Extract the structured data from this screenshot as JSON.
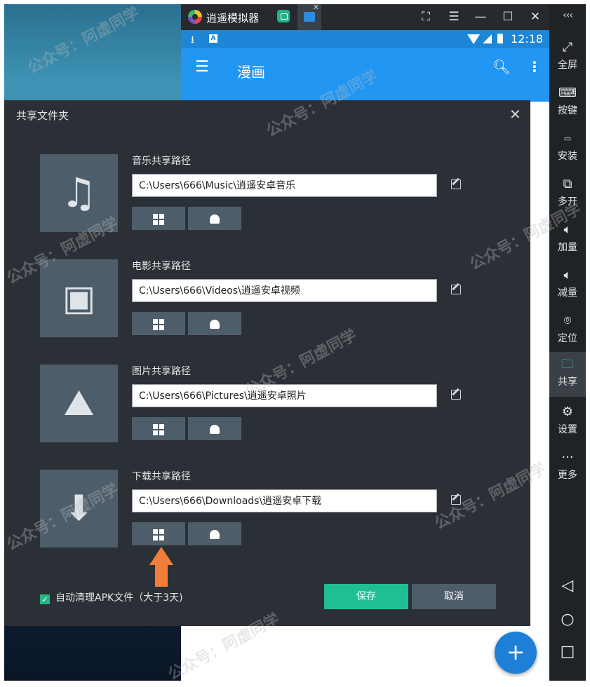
{
  "window": {
    "title": "逍遥模拟器",
    "status_time": "12:18",
    "app_title": "漫画"
  },
  "sidebar": {
    "items": [
      {
        "label": "全屏",
        "icon": "fullscreen-icon"
      },
      {
        "label": "按键",
        "icon": "keyboard-icon"
      },
      {
        "label": "安装",
        "icon": "apk-icon"
      },
      {
        "label": "多开",
        "icon": "multi-instance-icon"
      },
      {
        "label": "加量",
        "icon": "volume-up-icon"
      },
      {
        "label": "减量",
        "icon": "volume-down-icon"
      },
      {
        "label": "定位",
        "icon": "location-icon"
      },
      {
        "label": "共享",
        "icon": "folder-icon"
      },
      {
        "label": "设置",
        "icon": "gear-icon"
      },
      {
        "label": "更多",
        "icon": "more-icon"
      }
    ],
    "active": "共享"
  },
  "dialog": {
    "title": "共享文件夹",
    "sections": [
      {
        "label": "音乐共享路径",
        "path": "C:\\Users\\666\\Music\\逍遥安卓音乐",
        "icon": "music-note-icon"
      },
      {
        "label": "电影共享路径",
        "path": "C:\\Users\\666\\Videos\\逍遥安卓视频",
        "icon": "film-icon"
      },
      {
        "label": "图片共享路径",
        "path": "C:\\Users\\666\\Pictures\\逍遥安卓照片",
        "icon": "image-icon"
      },
      {
        "label": "下载共享路径",
        "path": "C:\\Users\\666\\Downloads\\逍遥安卓下载",
        "icon": "download-folder-icon"
      }
    ],
    "auto_clean_label": "自动清理APK文件（大于3天)",
    "auto_clean_checked": true,
    "save_label": "保存",
    "cancel_label": "取消"
  },
  "watermark": "公众号：阿虚同学",
  "colors": {
    "accent_green": "#1fbf93",
    "app_blue": "#2196f3",
    "dialog_bg": "#2b3036",
    "tile_bg": "#4e5d6a",
    "annotation_arrow": "#f27d3a"
  }
}
